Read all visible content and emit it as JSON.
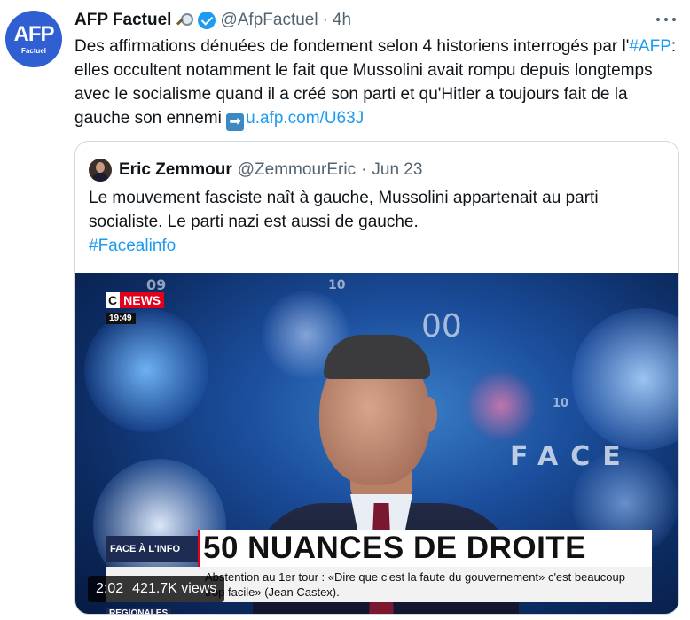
{
  "author": {
    "name": "AFP Factuel",
    "handle": "@AfpFactuel",
    "separator": "·",
    "time": "4h",
    "avatar_logo": "AFP",
    "avatar_sub": "Factuel",
    "icons": [
      "magnifying-glass-icon",
      "verified-badge-icon"
    ]
  },
  "menu": {
    "icon": "more-icon"
  },
  "tweet": {
    "text_1": "Des affirmations dénuées de fondement selon 4 historiens interrogés par l'",
    "hashtag": "#AFP",
    "text_2": ": elles occultent notamment le fait que Mussolini avait rompu depuis longtemps avec le socialisme quand il a créé son parti et qu'Hitler a toujours fait de la gauche son ennemi ",
    "arrow_emoji": "➡",
    "link": "u.afp.com/U63J"
  },
  "quoted_tweet": {
    "name": "Eric Zemmour",
    "handle": "@ZemmourEric",
    "separator": "·",
    "date": "Jun 23",
    "text": "Le mouvement fasciste naît à gauche, Mussolini appartenait au parti socialiste. Le parti nazi est aussi de gauche.",
    "hashtag": "#Facealinfo"
  },
  "video": {
    "channel_c": "C",
    "channel_news": "NEWS",
    "clock": "19:49",
    "studio_09": "09",
    "studio_10": "10",
    "studio_10b": "10",
    "studio_00": "00",
    "studio_face": "FACE",
    "show_label": "FACE À L'INFO",
    "headline": "50 NUANCES DE DROITE",
    "ticker_1": "Abstention au 1er tour : «Dire que c'est la faute du gouvernement» c'est beaucoup",
    "ticker_2": "trop facile» (Jean Castex).",
    "side_label": "REGIONALES",
    "duration": "2:02",
    "views": "421.7K views"
  }
}
